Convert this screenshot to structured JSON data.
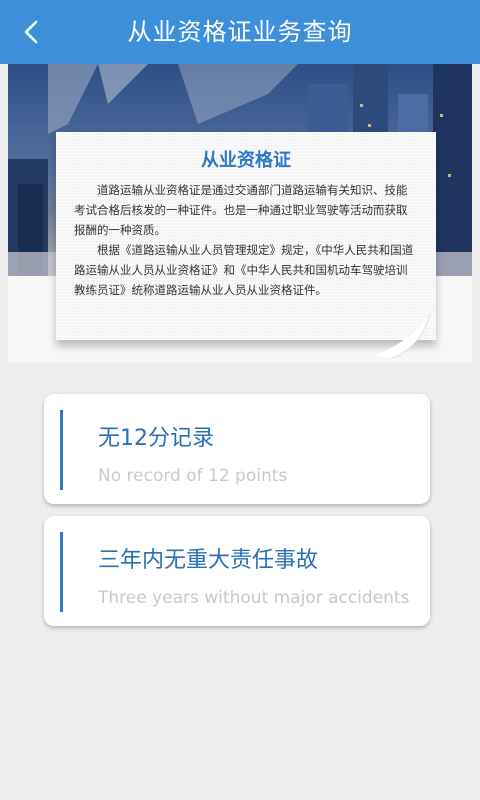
{
  "header": {
    "title": "从业资格证业务查询",
    "back_icon": "chevron-left-icon"
  },
  "banner": {
    "title": "从业资格证",
    "paragraphs": [
      "道路运输从业资格证是通过交通部门道路运输有关知识、技能考试合格后核发的一种证件。也是一种通过职业驾驶等活动而获取报酬的一种资质。",
      "根据《道路运输从业人员管理规定》规定，《中华人民共和国道路运输从业人员从业资格证》和《中华人民共和国机动车驾驶培训教练员证》统称道路运输从业人员从业资格证件。"
    ]
  },
  "cards": [
    {
      "title": "无12分记录",
      "subtitle": "No record of 12 points"
    },
    {
      "title": "三年内无重大责任事故",
      "subtitle": "Three years without major accidents"
    }
  ],
  "colors": {
    "header_bg": "#3d8fd9",
    "accent": "#3379c4",
    "title_text": "#2a6fb8",
    "subtitle_text": "#c9c9c9"
  }
}
